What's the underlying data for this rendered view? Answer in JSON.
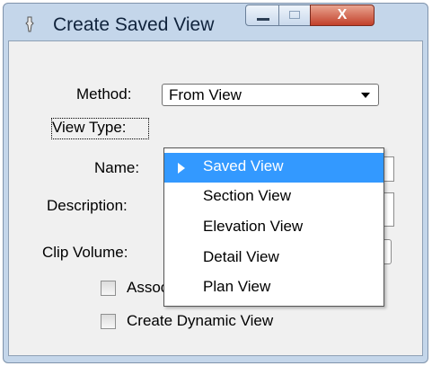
{
  "window": {
    "title": "Create Saved View",
    "close_glyph": "X",
    "app_icon": "pin-icon"
  },
  "form": {
    "method_label": "Method:",
    "method_value": "From View",
    "view_type_label": "View Type:",
    "name_label": "Name:",
    "description_label": "Description:",
    "clip_volume_label": "Clip Volume:",
    "associative_clip_label": "Associative Clip Volume",
    "associative_clip_checked": false,
    "dynamic_view_label": "Create Dynamic View",
    "dynamic_view_checked": false
  },
  "dropdown": {
    "selected_index": 0,
    "items": [
      {
        "label": "Saved View"
      },
      {
        "label": "Section View"
      },
      {
        "label": "Elevation View"
      },
      {
        "label": "Detail View"
      },
      {
        "label": "Plan View"
      }
    ]
  },
  "colors": {
    "selection": "#3399ff",
    "window_frame": "#c4d6ea",
    "close_button": "#c2402a"
  }
}
